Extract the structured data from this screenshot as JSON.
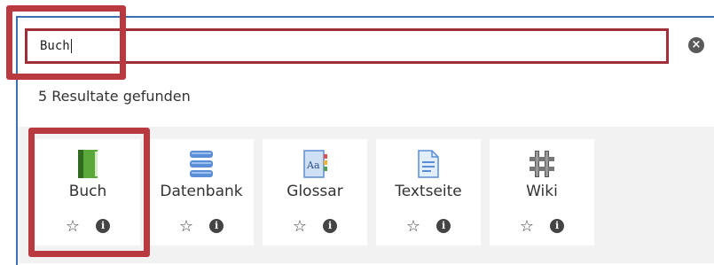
{
  "search": {
    "value": "Buch"
  },
  "clear_icon": "close-icon",
  "result_count": "5 Resultate gefunden",
  "results": [
    {
      "label": "Buch",
      "icon": "book-icon"
    },
    {
      "label": "Datenbank",
      "icon": "database-icon"
    },
    {
      "label": "Glossar",
      "icon": "glossary-icon"
    },
    {
      "label": "Textseite",
      "icon": "page-icon"
    },
    {
      "label": "Wiki",
      "icon": "wiki-icon"
    }
  ],
  "colors": {
    "highlight": "#b83a40",
    "frame_border": "#3d6fb3",
    "input_border": "#a03038"
  }
}
